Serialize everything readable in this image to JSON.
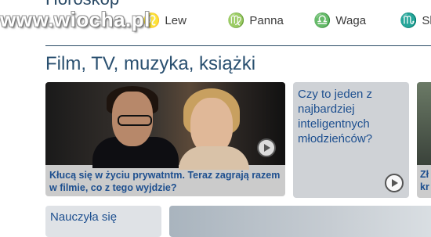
{
  "watermark": {
    "text": "www.wiocha.pl"
  },
  "horoscope": {
    "title": "Horoskop",
    "signs": [
      {
        "symbol": "♌",
        "label": "Lew",
        "color": "#7a3aa8"
      },
      {
        "symbol": "♍",
        "label": "Panna",
        "color": "#7a3aa8"
      },
      {
        "symbol": "♎",
        "label": "Waga",
        "color": "#1f8a76"
      },
      {
        "symbol": "♏",
        "label": "Sk",
        "color": "#7a3aa8"
      }
    ]
  },
  "section": {
    "title": "Film, TV, muzyka, książki"
  },
  "cards": {
    "main": {
      "caption": "Kłucą się w życiu prywatntm. Teraz zagrają razem w filmie, co z tego wyjdzie?"
    },
    "question": {
      "text": "Czy to jeden z najbardziej inteligentnych młodzieńców?"
    },
    "right": {
      "line1": "Zł",
      "line2": "kr"
    },
    "bottom_left": {
      "text": "Nauczyła się"
    }
  }
}
